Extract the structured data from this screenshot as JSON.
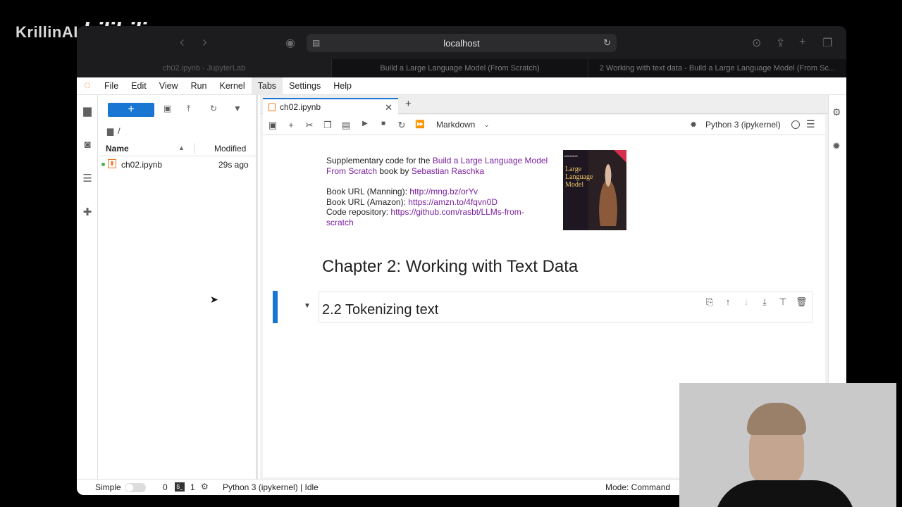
{
  "watermark": {
    "brand": "KrillinAI",
    "logo": "bilibili"
  },
  "browser": {
    "url": "localhost",
    "tabs": [
      {
        "title": "ch02.ipynb - JupyterLab",
        "active": true
      },
      {
        "title": "Build a Large Language Model (From Scratch)"
      },
      {
        "title": "2 Working with text data - Build a Large Language Model (From Sc..."
      }
    ]
  },
  "menu": [
    "File",
    "Edit",
    "View",
    "Run",
    "Kernel",
    "Tabs",
    "Settings",
    "Help"
  ],
  "filebrowser": {
    "new_label": "+",
    "path": "/",
    "columns": {
      "name": "Name",
      "modified": "Modified"
    },
    "files": [
      {
        "name": "ch02.ipynb",
        "modified": "29s ago"
      }
    ]
  },
  "notebook": {
    "tab_title": "ch02.ipynb",
    "cell_type": "Markdown",
    "kernel": "Python 3 (ipykernel)",
    "intro": {
      "line1_prefix": "Supplementary code for the ",
      "book_link": "Build a Large Language Model From Scratch",
      "line1_mid": " book by ",
      "author_link": "Sebastian Raschka",
      "manning_label": "Book URL (Manning): ",
      "manning_url": "http://mng.bz/orYv",
      "amazon_label": "Book URL (Amazon): ",
      "amazon_url": "https://amzn.to/4fqvn0D",
      "repo_label": "Code repository: ",
      "repo_url": "https://github.com/rasbt/LLMs-from-scratch"
    },
    "cover": {
      "series": "MANNING",
      "title_line1": "Large Language",
      "title_line2": "Model"
    },
    "heading1": "Chapter 2: Working with Text Data",
    "heading2": "2.2 Tokenizing text"
  },
  "status": {
    "mode_simple": "Simple",
    "count_a": "0",
    "count_b": "1",
    "kernel_status": "Python 3 (ipykernel) | Idle",
    "mode": "Mode: Command"
  },
  "colors": {
    "accent": "#1976d2",
    "link": "#7b1fa2",
    "jupyter_orange": "#f37726"
  }
}
